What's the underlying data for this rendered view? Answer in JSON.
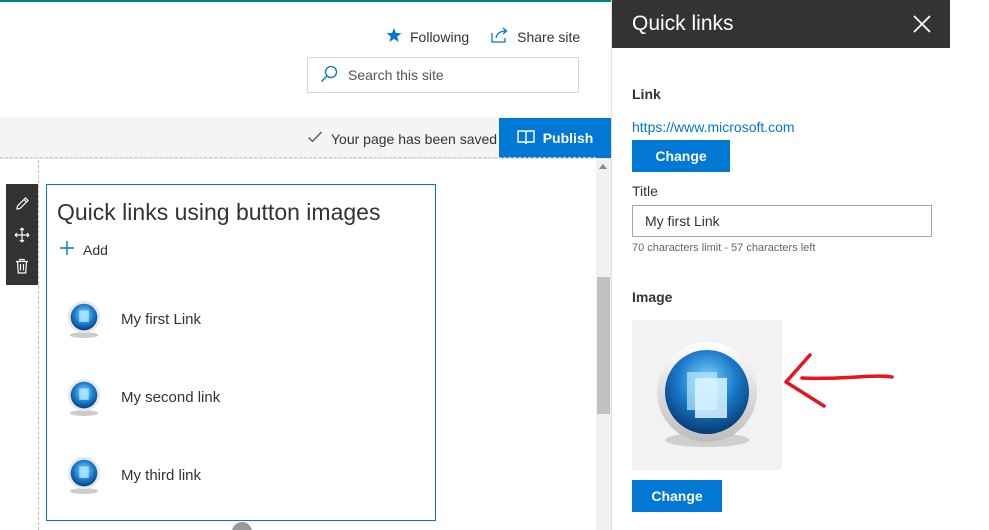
{
  "header": {
    "following_label": "Following",
    "share_label": "Share site",
    "search_placeholder": "Search this site"
  },
  "command_bar": {
    "saved_message": "Your page has been saved",
    "publish_label": "Publish"
  },
  "webpart": {
    "title": "Quick links using button images",
    "add_label": "Add",
    "links": [
      {
        "label": "My first Link"
      },
      {
        "label": "My second link"
      },
      {
        "label": "My third link"
      }
    ]
  },
  "panel": {
    "title": "Quick links",
    "link_label": "Link",
    "link_url": "https://www.microsoft.com",
    "change_label": "Change",
    "title_label": "Title",
    "title_value": "My first Link",
    "char_hint": "70 characters limit - 57 characters left",
    "image_label": "Image",
    "image_change_label": "Change"
  },
  "icons": [
    "star-icon",
    "share-icon",
    "search-icon",
    "checkmark-icon",
    "book-icon",
    "pencil-icon",
    "move-icon",
    "trash-icon",
    "plus-icon",
    "close-icon",
    "button-orb-icon",
    "red-arrow-annotation"
  ],
  "colors": {
    "accent": "#0078d4",
    "panel_header": "#333333",
    "annotation": "#e8141b"
  }
}
